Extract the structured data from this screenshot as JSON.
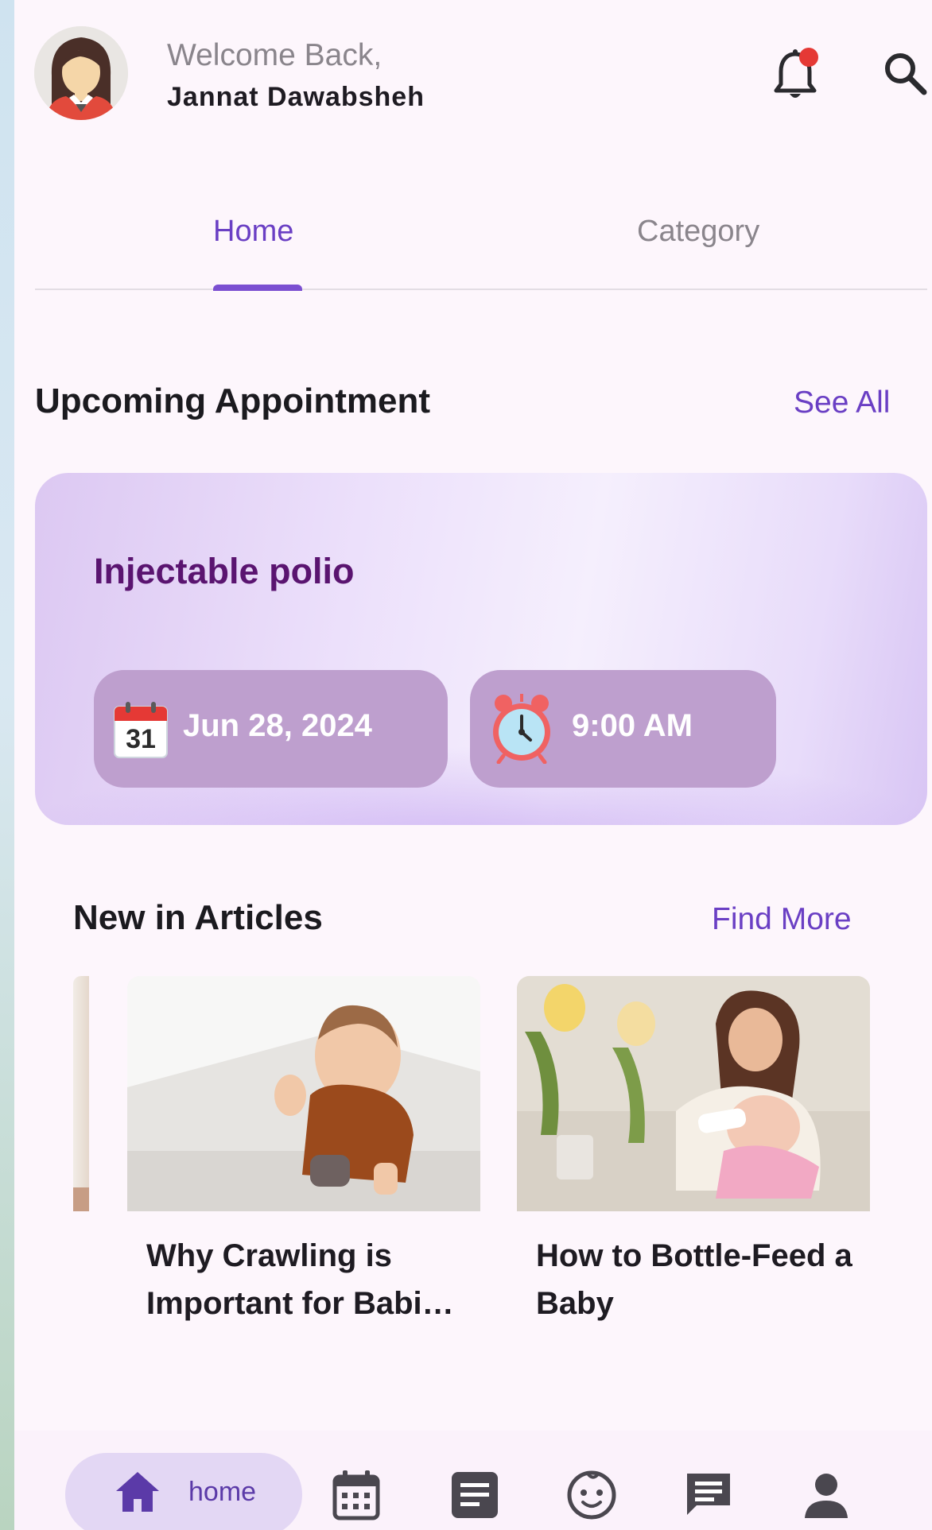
{
  "header": {
    "welcome": "Welcome Back,",
    "username": "Jannat Dawabsheh",
    "avatar_icon": "user-avatar",
    "notification_icon": "bell-icon",
    "search_icon": "search-icon"
  },
  "tabs": [
    {
      "label": "Home",
      "active": true
    },
    {
      "label": "Category",
      "active": false
    }
  ],
  "appointments": {
    "heading": "Upcoming Appointment",
    "see_all": "See All",
    "card": {
      "title": "Injectable polio",
      "date": "Jun 28, 2024",
      "date_icon_day": "31",
      "time": "9:00 AM"
    }
  },
  "articles": {
    "heading": "New in Articles",
    "find_more": "Find More",
    "items": [
      {
        "title": "Why Crawling is Important for Babi…",
        "image": "crawling-baby-photo"
      },
      {
        "title": "How to Bottle-Feed a Baby",
        "image": "bottle-feeding-photo"
      }
    ]
  },
  "bottom_nav": {
    "home_label": "home",
    "items": [
      "home-icon",
      "calendar-icon",
      "articles-icon",
      "baby-icon",
      "chat-icon",
      "profile-icon"
    ]
  },
  "colors": {
    "accent": "#6a3fc4",
    "appointment_title": "#5a1470",
    "pill": "#be9fce",
    "background": "#fdf6fc"
  }
}
